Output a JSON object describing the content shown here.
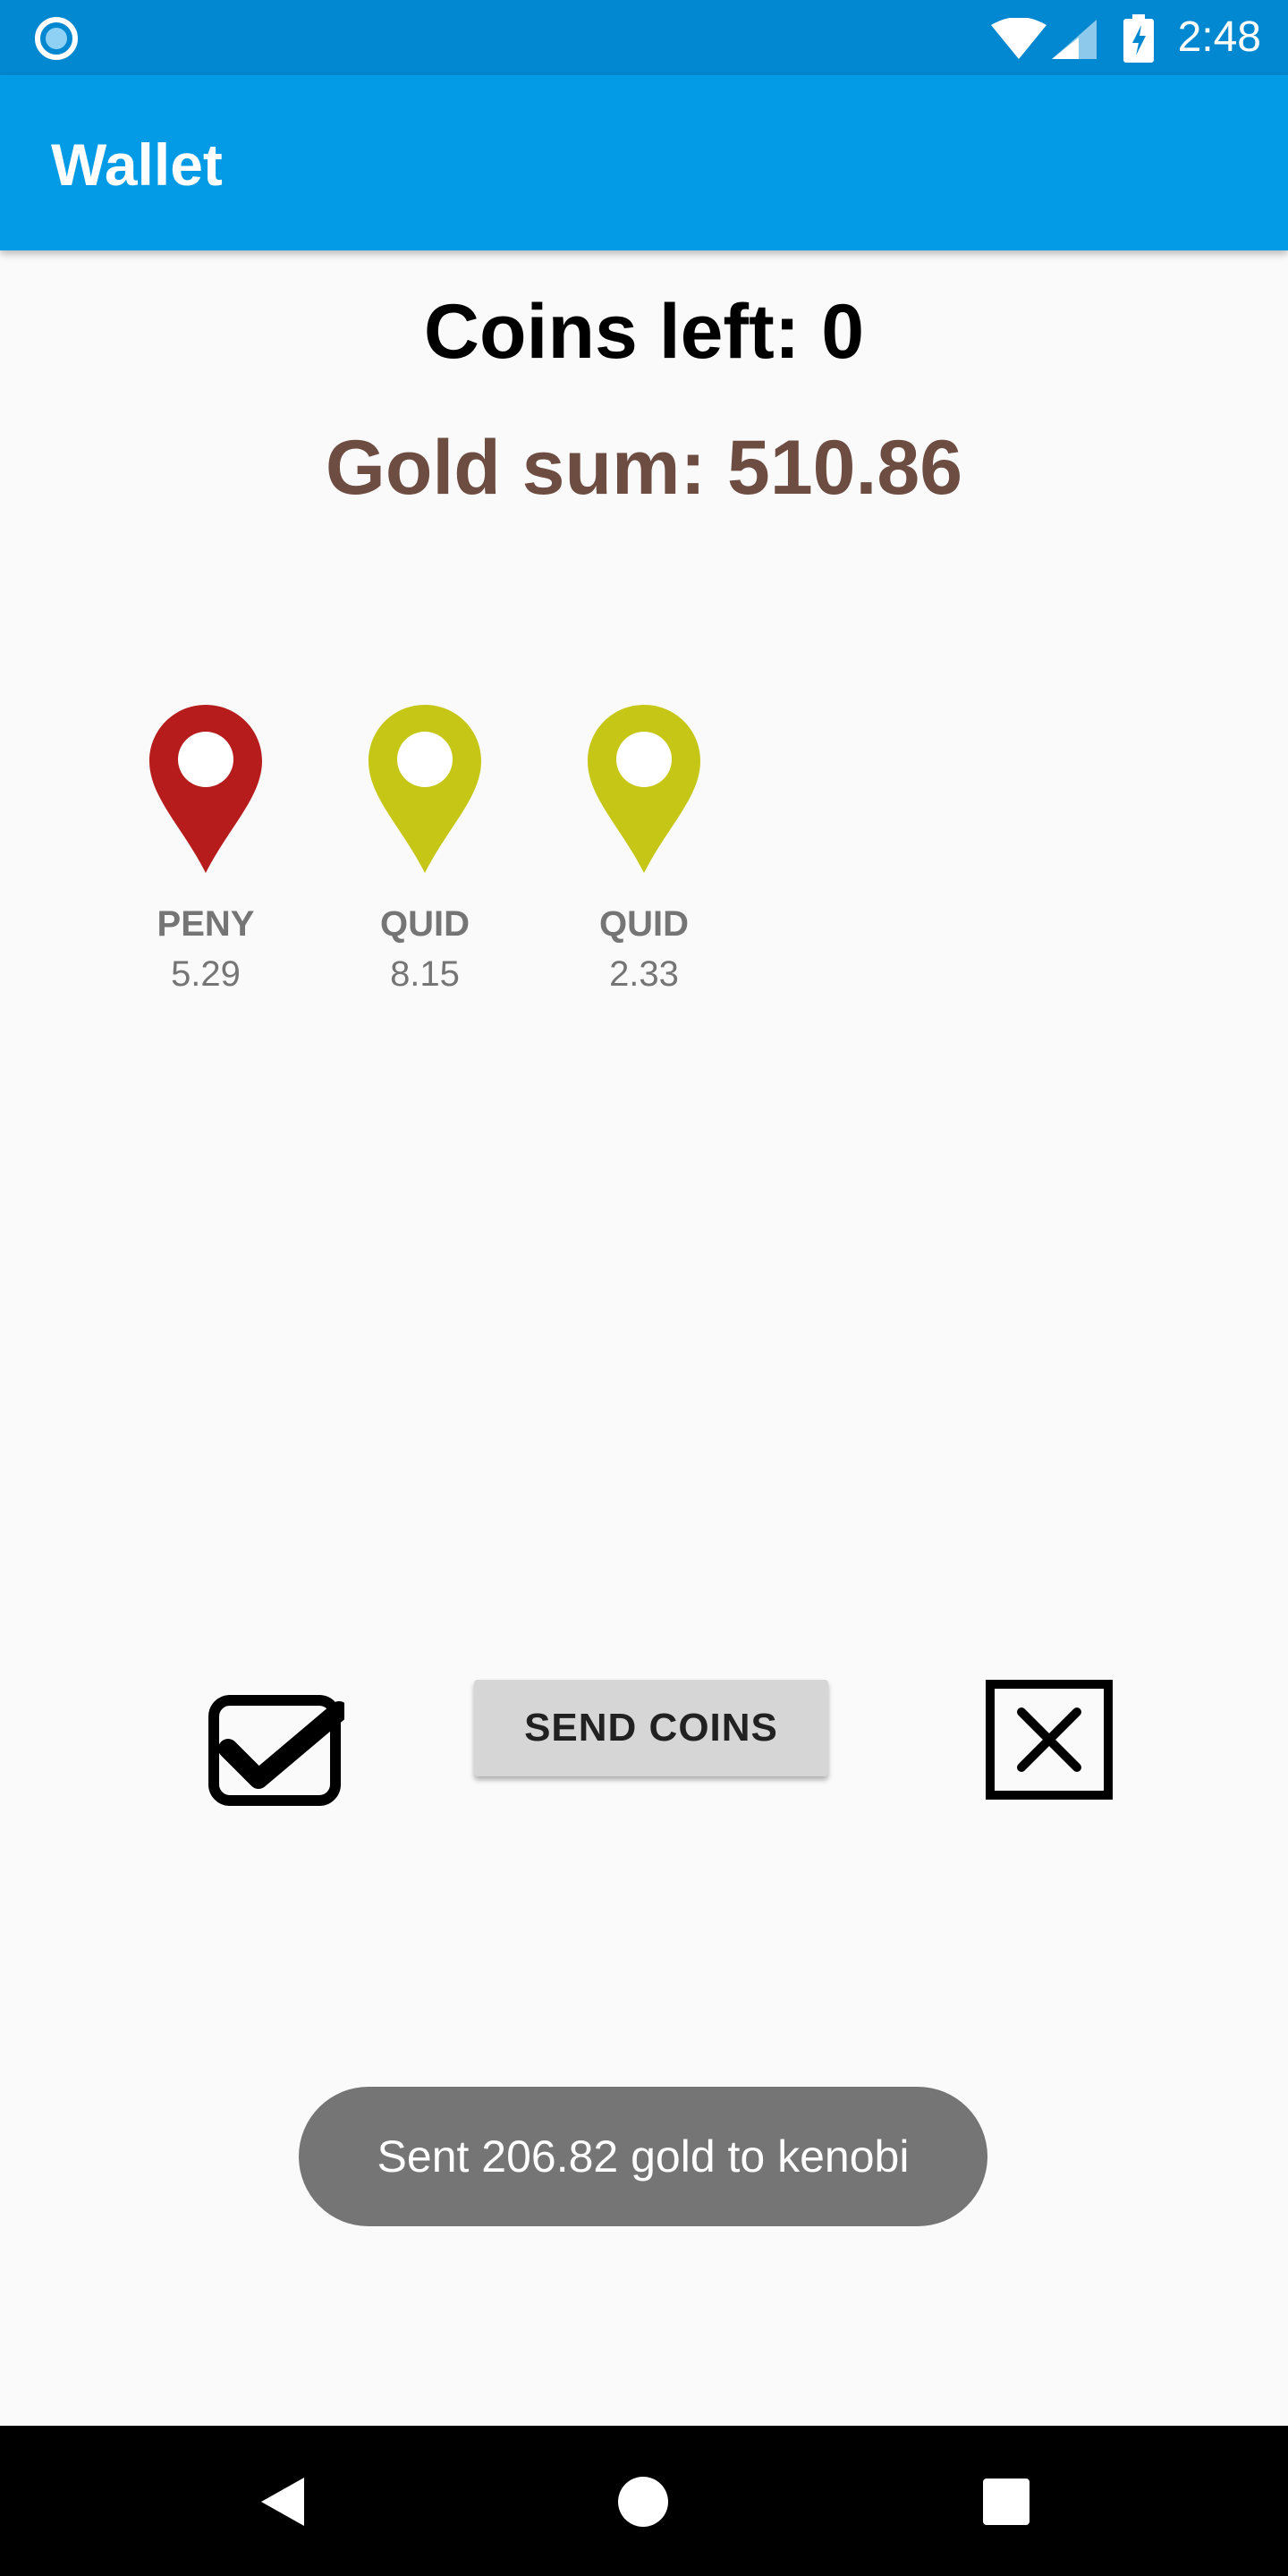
{
  "status_bar": {
    "time": "2:48",
    "icons": [
      "app-notification-icon",
      "wifi-icon",
      "signal-icon",
      "battery-charging-icon"
    ]
  },
  "app_bar": {
    "title": "Wallet"
  },
  "wallet": {
    "coins_left": "Coins left: 0",
    "gold_sum": "Gold sum: 510.86"
  },
  "coins": [
    {
      "currency": "PENY",
      "value": "5.29",
      "color": "#b71c1c"
    },
    {
      "currency": "QUID",
      "value": "8.15",
      "color": "#c6c616"
    },
    {
      "currency": "QUID",
      "value": "2.33",
      "color": "#c6c616"
    }
  ],
  "actions": {
    "select_all_icon": "checkbox-checked-icon",
    "send_label": "SEND COINS",
    "deselect_icon": "close-box-icon"
  },
  "toast": {
    "message": "Sent 206.82 gold to kenobi"
  },
  "nav_bar": {
    "icons": [
      "back-icon",
      "home-icon",
      "recents-icon"
    ]
  }
}
